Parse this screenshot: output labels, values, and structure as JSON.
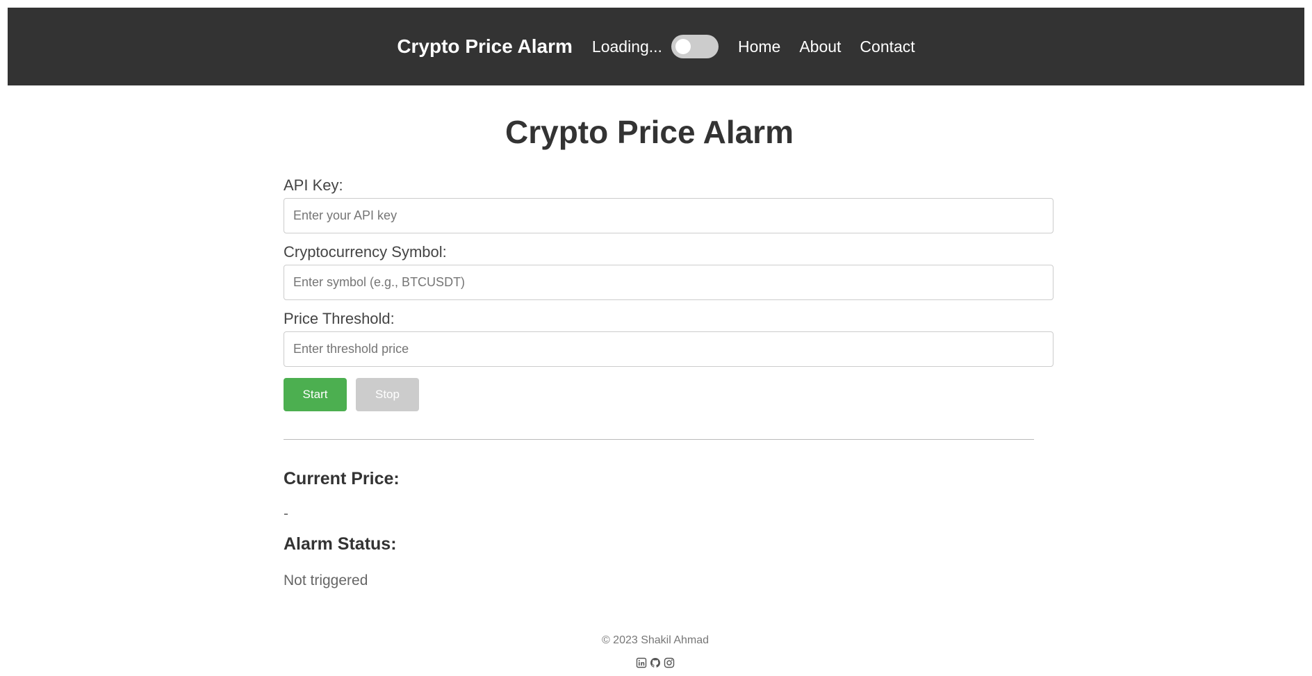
{
  "header": {
    "brand": "Crypto Price Alarm",
    "loading_text": "Loading...",
    "theme_toggle": {
      "state": "off"
    },
    "nav": [
      {
        "label": "Home"
      },
      {
        "label": "About"
      },
      {
        "label": "Contact"
      }
    ]
  },
  "main": {
    "title": "Crypto Price Alarm",
    "form": {
      "api_key": {
        "label": "API Key:",
        "placeholder": "Enter your API key",
        "value": ""
      },
      "symbol": {
        "label": "Cryptocurrency Symbol:",
        "placeholder": "Enter symbol (e.g., BTCUSDT)",
        "value": ""
      },
      "threshold": {
        "label": "Price Threshold:",
        "placeholder": "Enter threshold price",
        "value": ""
      }
    },
    "buttons": {
      "start_label": "Start",
      "stop_label": "Stop",
      "stop_disabled": true
    },
    "current_price": {
      "heading": "Current Price:",
      "value": "-"
    },
    "alarm_status": {
      "heading": "Alarm Status:",
      "value": "Not triggered"
    }
  },
  "footer": {
    "copyright": "© 2023 Shakil Ahmad",
    "social_icons": [
      "linkedin-icon",
      "github-icon",
      "instagram-icon"
    ]
  },
  "colors": {
    "navbar_bg": "#333333",
    "start_button": "#4caf50",
    "stop_button_disabled": "#cccccc",
    "toggle_off": "#cccccc"
  }
}
